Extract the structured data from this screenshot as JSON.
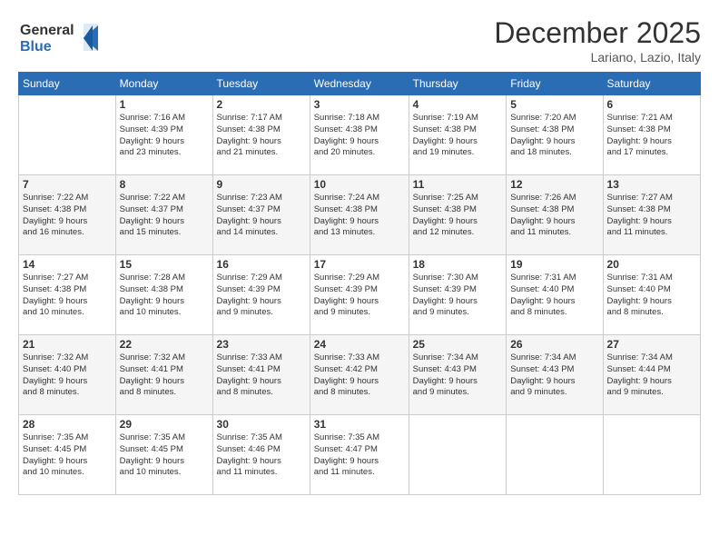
{
  "logo": {
    "line1": "General",
    "line2": "Blue"
  },
  "title": "December 2025",
  "location": "Lariano, Lazio, Italy",
  "days_of_week": [
    "Sunday",
    "Monday",
    "Tuesday",
    "Wednesday",
    "Thursday",
    "Friday",
    "Saturday"
  ],
  "weeks": [
    [
      {
        "num": "",
        "info": ""
      },
      {
        "num": "1",
        "info": "Sunrise: 7:16 AM\nSunset: 4:39 PM\nDaylight: 9 hours\nand 23 minutes."
      },
      {
        "num": "2",
        "info": "Sunrise: 7:17 AM\nSunset: 4:38 PM\nDaylight: 9 hours\nand 21 minutes."
      },
      {
        "num": "3",
        "info": "Sunrise: 7:18 AM\nSunset: 4:38 PM\nDaylight: 9 hours\nand 20 minutes."
      },
      {
        "num": "4",
        "info": "Sunrise: 7:19 AM\nSunset: 4:38 PM\nDaylight: 9 hours\nand 19 minutes."
      },
      {
        "num": "5",
        "info": "Sunrise: 7:20 AM\nSunset: 4:38 PM\nDaylight: 9 hours\nand 18 minutes."
      },
      {
        "num": "6",
        "info": "Sunrise: 7:21 AM\nSunset: 4:38 PM\nDaylight: 9 hours\nand 17 minutes."
      }
    ],
    [
      {
        "num": "7",
        "info": "Sunrise: 7:22 AM\nSunset: 4:38 PM\nDaylight: 9 hours\nand 16 minutes."
      },
      {
        "num": "8",
        "info": "Sunrise: 7:22 AM\nSunset: 4:37 PM\nDaylight: 9 hours\nand 15 minutes."
      },
      {
        "num": "9",
        "info": "Sunrise: 7:23 AM\nSunset: 4:37 PM\nDaylight: 9 hours\nand 14 minutes."
      },
      {
        "num": "10",
        "info": "Sunrise: 7:24 AM\nSunset: 4:38 PM\nDaylight: 9 hours\nand 13 minutes."
      },
      {
        "num": "11",
        "info": "Sunrise: 7:25 AM\nSunset: 4:38 PM\nDaylight: 9 hours\nand 12 minutes."
      },
      {
        "num": "12",
        "info": "Sunrise: 7:26 AM\nSunset: 4:38 PM\nDaylight: 9 hours\nand 11 minutes."
      },
      {
        "num": "13",
        "info": "Sunrise: 7:27 AM\nSunset: 4:38 PM\nDaylight: 9 hours\nand 11 minutes."
      }
    ],
    [
      {
        "num": "14",
        "info": "Sunrise: 7:27 AM\nSunset: 4:38 PM\nDaylight: 9 hours\nand 10 minutes."
      },
      {
        "num": "15",
        "info": "Sunrise: 7:28 AM\nSunset: 4:38 PM\nDaylight: 9 hours\nand 10 minutes."
      },
      {
        "num": "16",
        "info": "Sunrise: 7:29 AM\nSunset: 4:39 PM\nDaylight: 9 hours\nand 9 minutes."
      },
      {
        "num": "17",
        "info": "Sunrise: 7:29 AM\nSunset: 4:39 PM\nDaylight: 9 hours\nand 9 minutes."
      },
      {
        "num": "18",
        "info": "Sunrise: 7:30 AM\nSunset: 4:39 PM\nDaylight: 9 hours\nand 9 minutes."
      },
      {
        "num": "19",
        "info": "Sunrise: 7:31 AM\nSunset: 4:40 PM\nDaylight: 9 hours\nand 8 minutes."
      },
      {
        "num": "20",
        "info": "Sunrise: 7:31 AM\nSunset: 4:40 PM\nDaylight: 9 hours\nand 8 minutes."
      }
    ],
    [
      {
        "num": "21",
        "info": "Sunrise: 7:32 AM\nSunset: 4:40 PM\nDaylight: 9 hours\nand 8 minutes."
      },
      {
        "num": "22",
        "info": "Sunrise: 7:32 AM\nSunset: 4:41 PM\nDaylight: 9 hours\nand 8 minutes."
      },
      {
        "num": "23",
        "info": "Sunrise: 7:33 AM\nSunset: 4:41 PM\nDaylight: 9 hours\nand 8 minutes."
      },
      {
        "num": "24",
        "info": "Sunrise: 7:33 AM\nSunset: 4:42 PM\nDaylight: 9 hours\nand 8 minutes."
      },
      {
        "num": "25",
        "info": "Sunrise: 7:34 AM\nSunset: 4:43 PM\nDaylight: 9 hours\nand 9 minutes."
      },
      {
        "num": "26",
        "info": "Sunrise: 7:34 AM\nSunset: 4:43 PM\nDaylight: 9 hours\nand 9 minutes."
      },
      {
        "num": "27",
        "info": "Sunrise: 7:34 AM\nSunset: 4:44 PM\nDaylight: 9 hours\nand 9 minutes."
      }
    ],
    [
      {
        "num": "28",
        "info": "Sunrise: 7:35 AM\nSunset: 4:45 PM\nDaylight: 9 hours\nand 10 minutes."
      },
      {
        "num": "29",
        "info": "Sunrise: 7:35 AM\nSunset: 4:45 PM\nDaylight: 9 hours\nand 10 minutes."
      },
      {
        "num": "30",
        "info": "Sunrise: 7:35 AM\nSunset: 4:46 PM\nDaylight: 9 hours\nand 11 minutes."
      },
      {
        "num": "31",
        "info": "Sunrise: 7:35 AM\nSunset: 4:47 PM\nDaylight: 9 hours\nand 11 minutes."
      },
      {
        "num": "",
        "info": ""
      },
      {
        "num": "",
        "info": ""
      },
      {
        "num": "",
        "info": ""
      }
    ]
  ]
}
